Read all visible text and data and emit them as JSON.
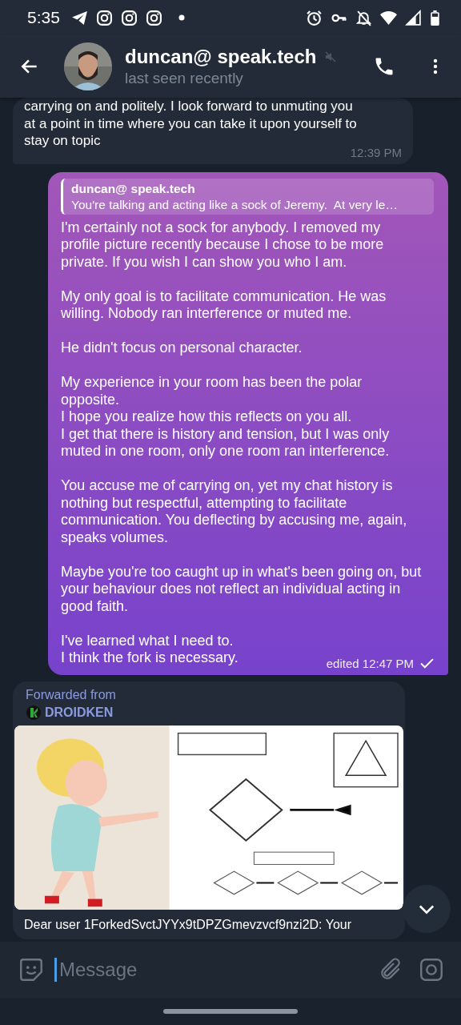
{
  "status_bar": {
    "time": "5:35"
  },
  "header": {
    "name": "duncan@ speak.tech",
    "status": "last seen recently",
    "muted": true
  },
  "messages": [
    {
      "kind": "incoming",
      "text": "carrying on and politely. I look forward to unmuting you\nat a point in time where you can take it upon yourself to\nstay on topic",
      "time": "12:39 PM"
    },
    {
      "kind": "outgoing",
      "reply": {
        "author": "duncan@ speak.tech",
        "text": "You're talking and acting like a sock of Jeremy.  At very le…"
      },
      "paragraphs": [
        "I'm certainly not a sock for anybody. I removed my profile picture recently because I chose to be more private. If you wish I can show you who I am.",
        "My only goal is to facilitate communication. He was willing. Nobody ran interference or muted me.",
        "He didn't focus on personal character.",
        "My experience in your room has been the polar opposite.\nI hope you realize how this reflects on you all.\nI get that there is history and tension, but I was only muted in one room, only one room ran interference.",
        "You accuse me of carrying on, yet my chat history is nothing but respectful, attempting to facilitate communication. You deflecting by accusing me, again, speaks volumes.",
        "Maybe you're too caught up in what's been going on, but your behaviour does not reflect an individual acting in good faith.",
        "I've learned what I need to.\nI think the fork is necessary."
      ],
      "time": "edited 12:47 PM",
      "sent": true
    },
    {
      "kind": "forwarded",
      "forwarded_label": "Forwarded from",
      "source": "DROIDKEN",
      "caption": "Dear user 1ForkedSvctJYYx9tDPZGmevzvcf9nzi2D: Your"
    }
  ],
  "composer": {
    "placeholder": "Message"
  }
}
